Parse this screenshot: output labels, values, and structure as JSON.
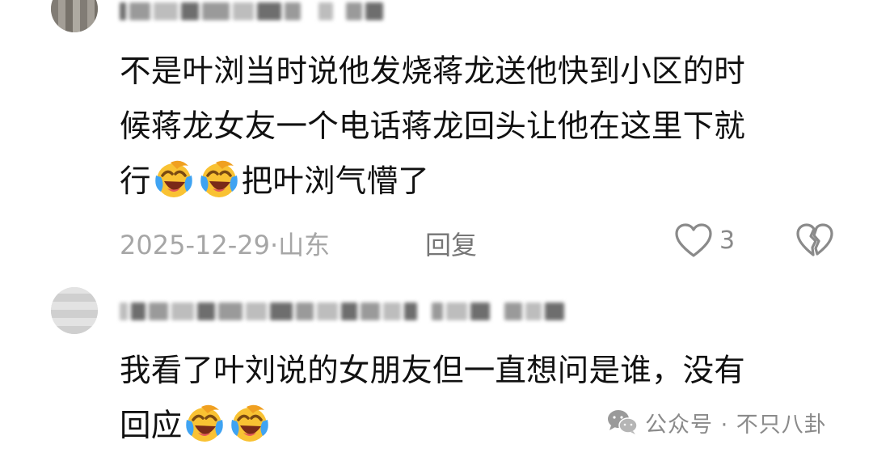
{
  "comments": [
    {
      "username": "",
      "text_line1": "不是叶浏当时说他发烧蒋龙送他快到小区的时",
      "text_line2": "候蒋龙女友一个电话蒋龙回头让他在这里下就",
      "text_line3_a": "行",
      "text_line3_b": "把叶浏气懵了",
      "emojis": [
        "laughing-crying-emoji",
        "laughing-crying-emoji"
      ],
      "date": "2025-12-29",
      "separator": "·",
      "location": "山东",
      "reply_label": "回复",
      "like_count": "3"
    },
    {
      "username": "",
      "text_line1": "我看了叶刘说的女朋友但一直想问是谁，没有",
      "text_line2": "回应",
      "emojis": [
        "laughing-crying-emoji",
        "laughing-crying-emoji"
      ]
    }
  ],
  "watermark": {
    "text": "公众号 · 不只八卦"
  },
  "colors": {
    "text": "#111111",
    "meta": "#a6a6a6",
    "emoji_face": "#f9c233"
  }
}
